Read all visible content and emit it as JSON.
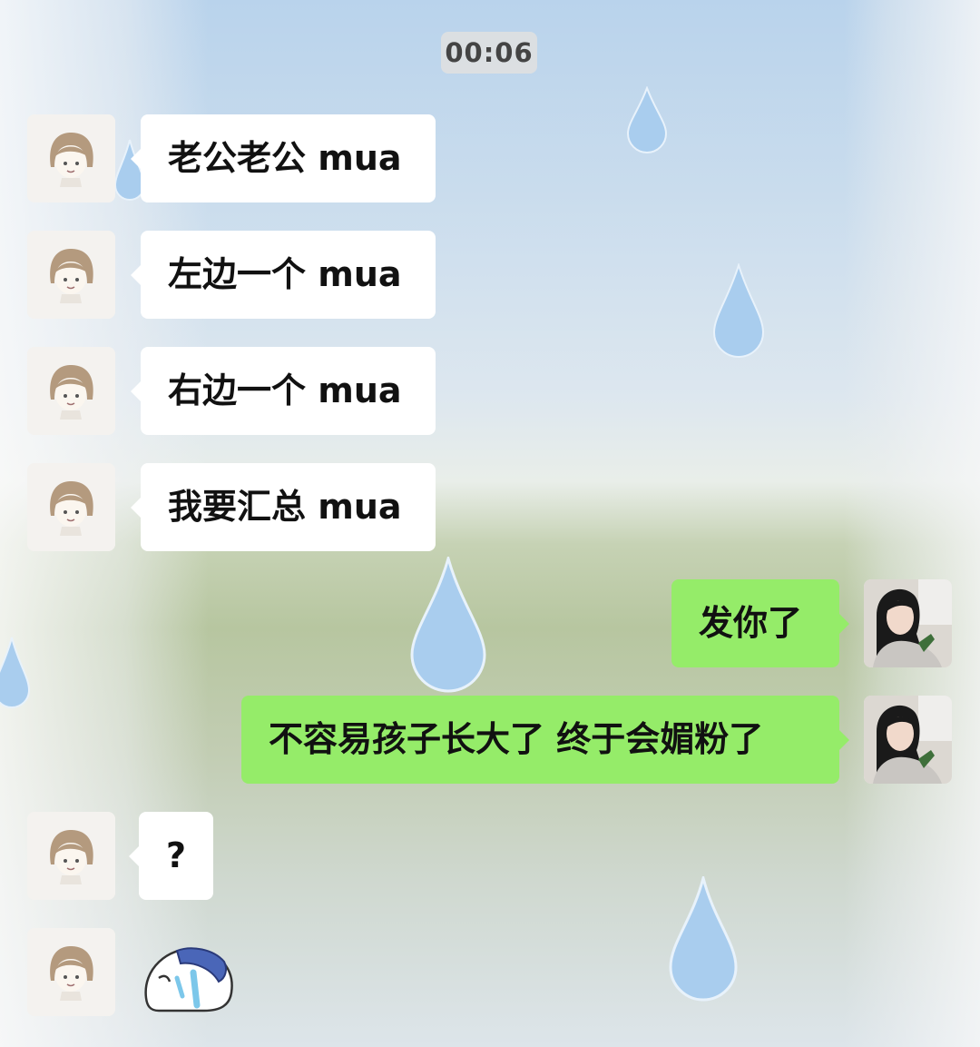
{
  "chat": {
    "timestamp": "00:06",
    "messages": [
      {
        "from": "other",
        "text": "老公老公 mua"
      },
      {
        "from": "other",
        "text": "左边一个 mua"
      },
      {
        "from": "other",
        "text": "右边一个 mua"
      },
      {
        "from": "other",
        "text": "我要汇总 mua"
      },
      {
        "from": "self",
        "text": "发你了"
      },
      {
        "from": "self",
        "text": "不容易孩子长大了 终于会媚粉了"
      },
      {
        "from": "other",
        "text": "?"
      },
      {
        "from": "other",
        "sticker": "crying-cartoon-sticker"
      }
    ]
  },
  "colors": {
    "bubble_self": "#95ec69",
    "bubble_other": "#ffffff",
    "timestamp_bg": "#e1e1e1"
  }
}
